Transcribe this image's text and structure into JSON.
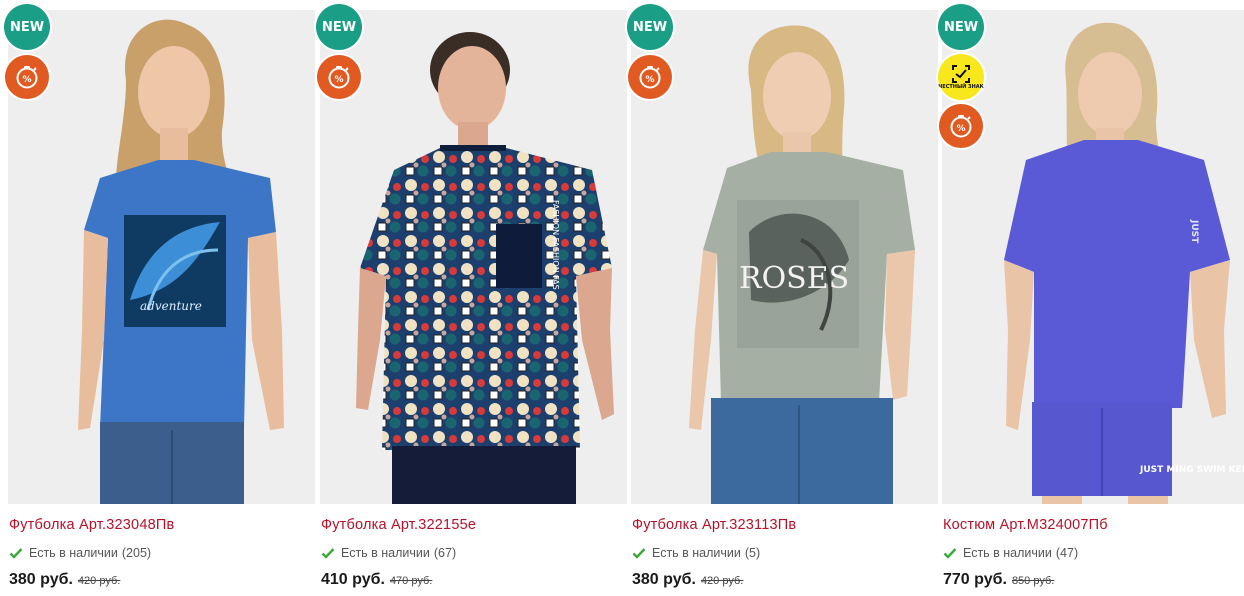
{
  "badges": {
    "new_label": "NEW",
    "znak_label": "ЧЕСТНЫЙ ЗНАК"
  },
  "colors": {
    "title": "#b5122a",
    "new_badge": "#1a9f86",
    "sale_badge": "#e05a22",
    "znak_badge": "#f8e71c",
    "check": "#3ca83c"
  },
  "products": [
    {
      "title": "Футболка Арт.323048Пв",
      "stock_text": "Есть в наличии",
      "stock_count": "(205)",
      "price": "380 руб.",
      "old_price": "420 руб.",
      "badges": [
        "new",
        "sale"
      ],
      "photo_print": "adventure"
    },
    {
      "title": "Футболка Арт.322155е",
      "stock_text": "Есть в наличии",
      "stock_count": "(67)",
      "price": "410 руб.",
      "old_price": "470 руб.",
      "badges": [
        "new",
        "sale"
      ],
      "photo_print": "FASHION FASHION FAS"
    },
    {
      "title": "Футболка Арт.323113Пв",
      "stock_text": "Есть в наличии",
      "stock_count": "(5)",
      "price": "380 руб.",
      "old_price": "420 руб.",
      "badges": [
        "new",
        "sale"
      ],
      "photo_print": "ROSES"
    },
    {
      "title": "Костюм Арт.М324007Пб",
      "stock_text": "Есть в наличии",
      "stock_count": "(47)",
      "price": "770 руб.",
      "old_price": "850 руб.",
      "badges": [
        "new",
        "znak",
        "sale"
      ],
      "photo_print": "JUST MING SWIM KEEP"
    }
  ]
}
